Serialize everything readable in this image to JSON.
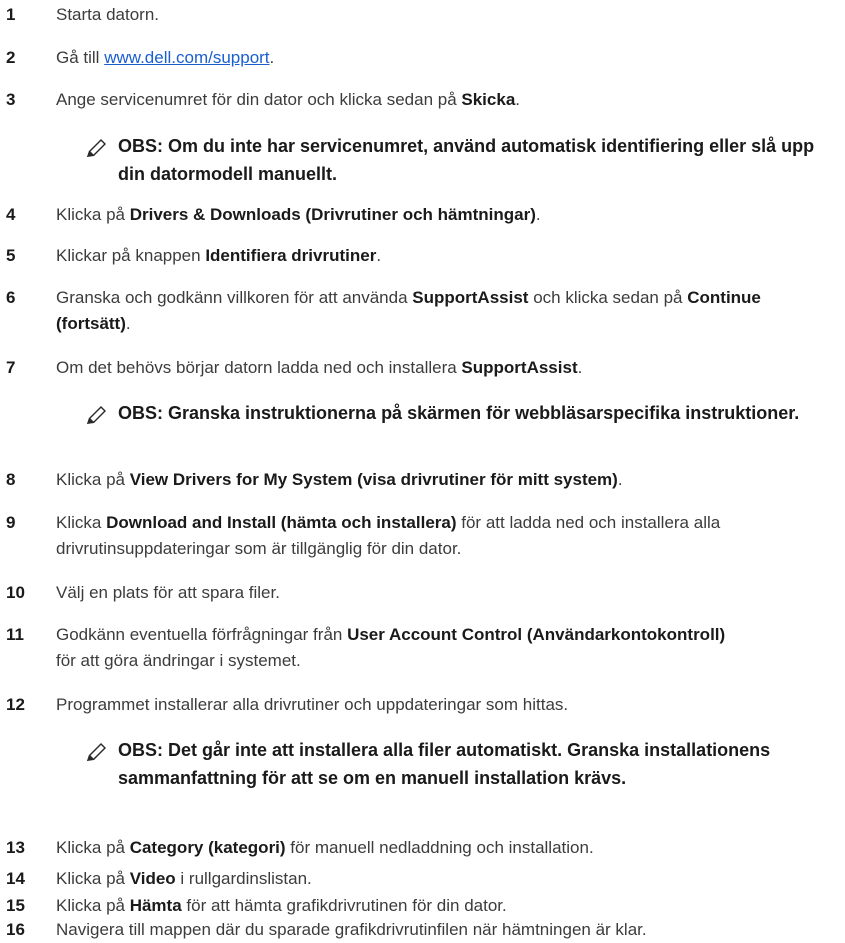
{
  "steps": [
    {
      "num": "1",
      "parts": [
        "Starta datorn."
      ]
    },
    {
      "num": "2",
      "pre": "Gå till ",
      "link": "www.dell.com/support",
      "post": "."
    },
    {
      "num": "3",
      "pre": "Ange servicenumret för din dator och klicka sedan på ",
      "bold": "Skicka",
      "post": "."
    },
    {
      "num": "4",
      "pre": "Klicka på ",
      "bold": "Drivers & Downloads (Drivrutiner och hämtningar)",
      "post": "."
    },
    {
      "num": "5",
      "pre": "Klickar på knappen ",
      "bold": "Identifiera drivrutiner",
      "post": "."
    },
    {
      "num": "6",
      "pre": "Granska och godkänn villkoren för att använda ",
      "bold": "SupportAssist",
      "mid": " och klicka sedan på ",
      "bold2": "Continue (fortsätt)",
      "post": "."
    },
    {
      "num": "7",
      "pre": "Om det behövs börjar datorn ladda ned och installera ",
      "bold": "SupportAssist",
      "post": "."
    },
    {
      "num": "8",
      "pre": "Klicka på ",
      "bold": "View Drivers for My System (visa drivrutiner för mitt system)",
      "post": "."
    },
    {
      "num": "9",
      "pre": "Klicka ",
      "bold": "Download and Install (hämta och installera)",
      "post": " för att ladda ned och installera alla drivrutinsuppdateringar som är tillgänglig för din dator."
    },
    {
      "num": "10",
      "pre": "Välj en plats för att spara filer."
    },
    {
      "num": "11",
      "pre": "Godkänn eventuella förfrågningar från ",
      "bold": "User Account Control (Användarkontokontroll)",
      "post": " för att göra ändringar i systemet."
    },
    {
      "num": "12",
      "pre": "Programmet installerar alla drivrutiner och uppdateringar som hittas."
    },
    {
      "num": "13",
      "pre": "Klicka på ",
      "bold": "Category (kategori)",
      "post": " för manuell nedladdning och installation."
    },
    {
      "num": "14",
      "pre": "Klicka på ",
      "bold": "Video",
      "post": " i rullgardinslistan."
    },
    {
      "num": "15",
      "pre": "Klicka på ",
      "bold": "Hämta",
      "post": " för att hämta grafikdrivrutinen för din dator."
    },
    {
      "num": "16",
      "pre": "Navigera till mappen där du sparade grafikdrivrutinfilen när hämtningen är klar."
    }
  ],
  "notes": [
    "OBS: Om du inte har servicenumret, använd automatisk identifiering eller slå upp din datormodell manuellt.",
    "OBS: Granska instruktionerna på skärmen för webbläsarspecifika instruktioner.",
    "OBS: Det går inte att installera alla filer automatiskt. Granska installationens sammanfattning för att se om en manuell installation krävs."
  ],
  "colors": {
    "text": "#3c3c3c",
    "bold": "#1a1a1a",
    "link": "#1a5fd0"
  },
  "icons": {
    "note": "pencil-note-icon"
  }
}
